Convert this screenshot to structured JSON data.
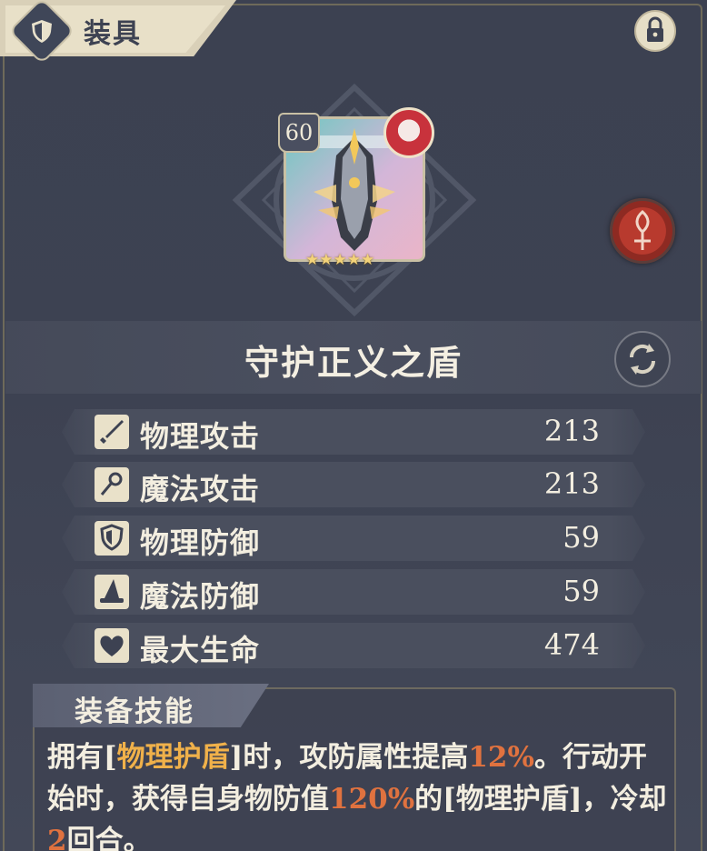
{
  "header": {
    "title": "装具"
  },
  "item": {
    "level": "60",
    "name": "守护正义之盾",
    "stars": "★★★★★"
  },
  "stats": [
    {
      "icon": "sword-icon",
      "label": "物理攻击",
      "value": "213"
    },
    {
      "icon": "wand-icon",
      "label": "魔法攻击",
      "value": "213"
    },
    {
      "icon": "shield-icon",
      "label": "物理防御",
      "value": "59"
    },
    {
      "icon": "wizard-hat-icon",
      "label": "魔法防御",
      "value": "59"
    },
    {
      "icon": "heart-icon",
      "label": "最大生命",
      "value": "474"
    }
  ],
  "skill": {
    "title": "装备技能",
    "desc_1": "拥有[",
    "desc_2": "物理护盾",
    "desc_3": "]时，攻防属性提高",
    "desc_4": "12%",
    "desc_5": "。行动开始时，获得自身物防值",
    "desc_6": "120%",
    "desc_7": "的[物理护盾]，冷却",
    "desc_8": "2",
    "desc_9": "回合。"
  },
  "colors": {
    "gold_highlight": "#f0b14a",
    "orange_highlight": "#e0723f",
    "text": "#f3eee0"
  }
}
